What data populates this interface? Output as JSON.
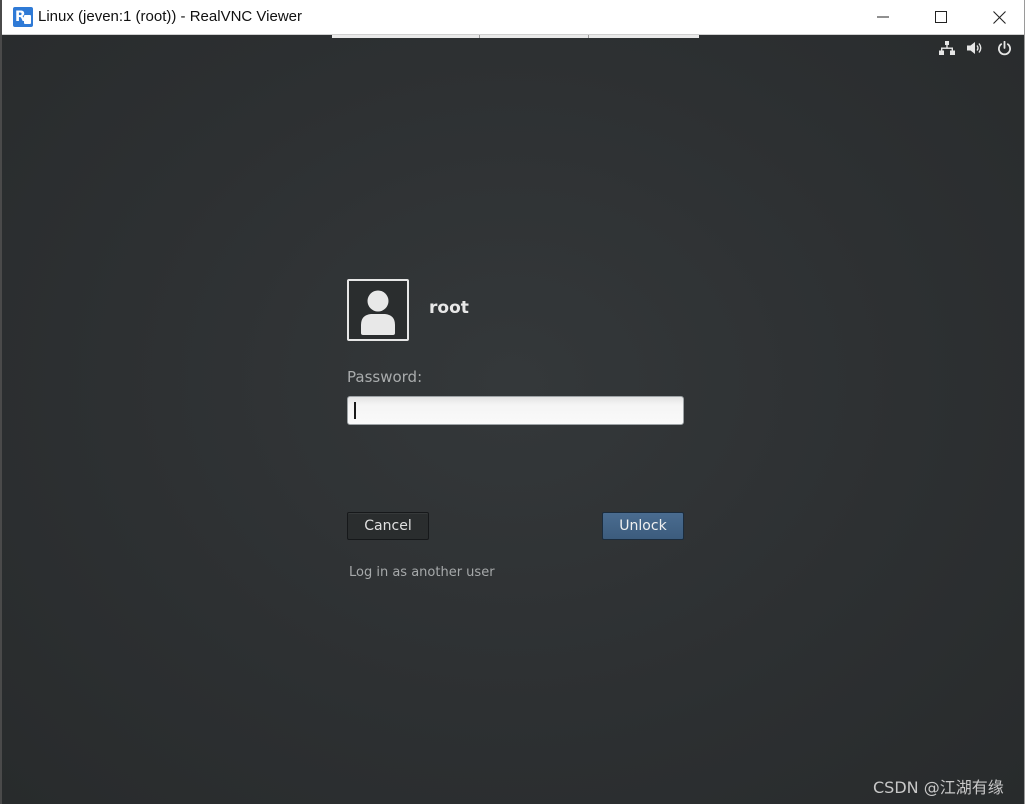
{
  "window": {
    "title": "Linux (jeven:1 (root)) - RealVNC Viewer",
    "app_icon": "realvnc-icon",
    "controls": [
      "minimize-icon",
      "maximize-icon",
      "close-icon"
    ]
  },
  "system_tray": {
    "icons": [
      "network-icon",
      "volume-icon",
      "power-icon"
    ]
  },
  "lock_screen": {
    "avatar_icon": "user-avatar-icon",
    "username": "root",
    "password_label": "Password:",
    "password_value": "",
    "cancel_label": "Cancel",
    "unlock_label": "Unlock",
    "another_user_link": "Log in as another user"
  },
  "watermark": "CSDN @江湖有缘",
  "colors": {
    "desktop_bg": "#2d3032",
    "unlock_button": "#44658a",
    "title_bar": "#ffffff"
  }
}
